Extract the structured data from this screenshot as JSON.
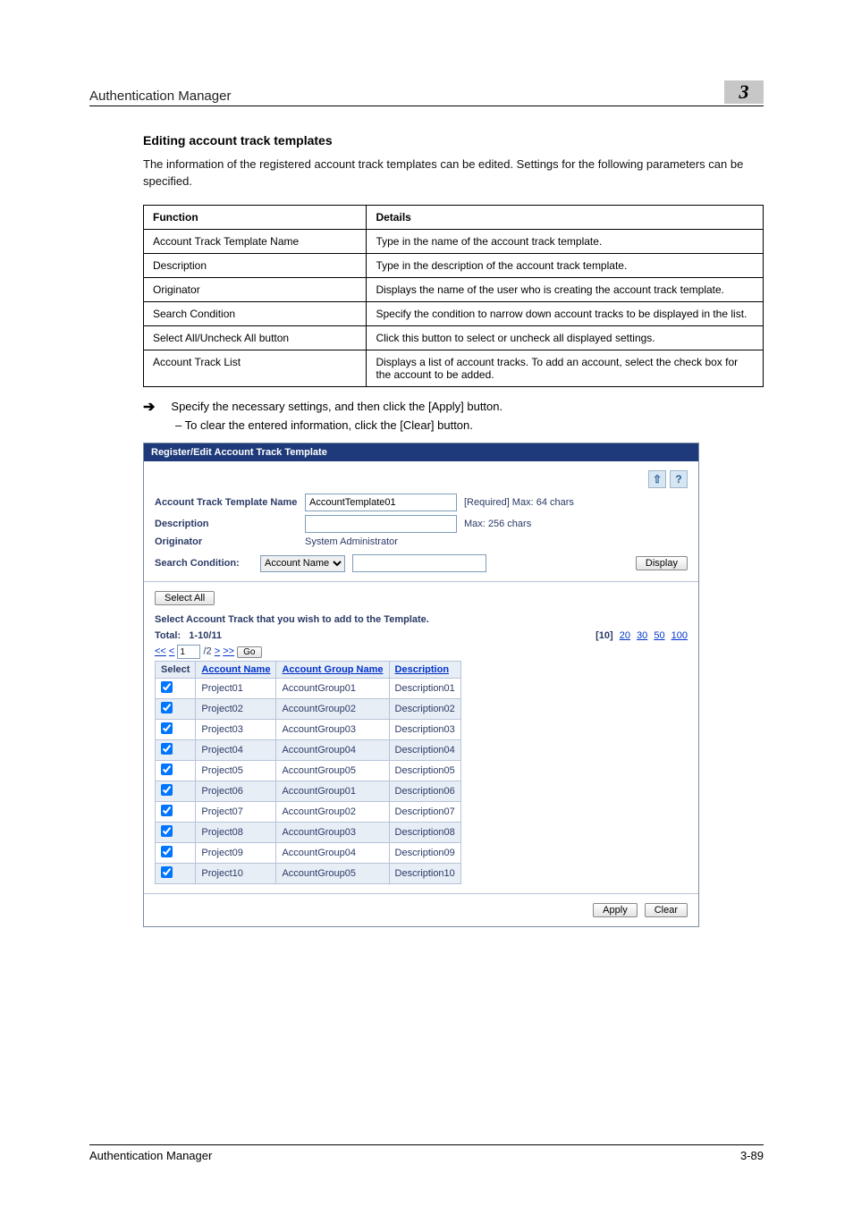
{
  "header": {
    "left": "Authentication Manager",
    "right": "3"
  },
  "section": {
    "title": "Editing account track templates",
    "body": "The information of the registered account track templates can be edited. Settings for the following parameters can be specified."
  },
  "spec": {
    "head": {
      "c1": "Function",
      "c2": "Details"
    },
    "rows": [
      {
        "c1": "Account Track Template Name",
        "c2": "Type in the name of the account track template."
      },
      {
        "c1": "Description",
        "c2": "Type in the description of the account track template."
      },
      {
        "c1": "Originator",
        "c2": "Displays the name of the user who is creating the account track template."
      },
      {
        "c1": "Search Condition",
        "c2": "Specify the condition to narrow down account tracks to be displayed in the list."
      },
      {
        "c1": "Select All/Uncheck All button",
        "c2": "Click this button to select or uncheck all displayed settings."
      },
      {
        "c1": "Account Track List",
        "c2": "Displays a list of account tracks. To add an account, select the check box for the account to be added."
      }
    ]
  },
  "instruct": {
    "main": "Specify the necessary settings, and then click the [Apply] button.",
    "sub": "–   To clear the entered information, click the [Clear] button."
  },
  "panel": {
    "title": "Register/Edit Account Track Template",
    "icons": {
      "up": "⇧",
      "help": "?"
    },
    "rows": {
      "name": {
        "label": "Account Track Template Name",
        "value": "AccountTemplate01",
        "hint": "[Required] Max: 64 chars"
      },
      "desc": {
        "label": "Description",
        "hint": "Max: 256 chars"
      },
      "orig": {
        "label": "Originator",
        "value": "System Administrator"
      },
      "search": {
        "label": "Search Condition:",
        "option": "Account Name",
        "button": "Display"
      }
    },
    "selectall": "Select All",
    "listhead": "Select Account Track that you wish to add to the Template.",
    "total": {
      "label": "Total:",
      "range": "1-10/11"
    },
    "pagesize": {
      "prefix": "[10]",
      "links": [
        "20",
        "30",
        "50",
        "100"
      ]
    },
    "pager": {
      "ll": "<<",
      "l": "<",
      "page": "1",
      "of": "/2",
      "r": ">",
      "rr": ">>",
      "go": "Go"
    },
    "grid": {
      "head": {
        "sel": "Select",
        "an": "Account Name",
        "agn": "Account Group Name",
        "desc": "Description"
      },
      "rows": [
        {
          "an": "Project01",
          "agn": "AccountGroup01",
          "d": "Description01"
        },
        {
          "an": "Project02",
          "agn": "AccountGroup02",
          "d": "Description02"
        },
        {
          "an": "Project03",
          "agn": "AccountGroup03",
          "d": "Description03"
        },
        {
          "an": "Project04",
          "agn": "AccountGroup04",
          "d": "Description04"
        },
        {
          "an": "Project05",
          "agn": "AccountGroup05",
          "d": "Description05"
        },
        {
          "an": "Project06",
          "agn": "AccountGroup01",
          "d": "Description06"
        },
        {
          "an": "Project07",
          "agn": "AccountGroup02",
          "d": "Description07"
        },
        {
          "an": "Project08",
          "agn": "AccountGroup03",
          "d": "Description08"
        },
        {
          "an": "Project09",
          "agn": "AccountGroup04",
          "d": "Description09"
        },
        {
          "an": "Project10",
          "agn": "AccountGroup05",
          "d": "Description10"
        }
      ]
    },
    "apply": "Apply",
    "clear": "Clear"
  },
  "footer": {
    "left": "Authentication Manager",
    "right": "3-89"
  }
}
